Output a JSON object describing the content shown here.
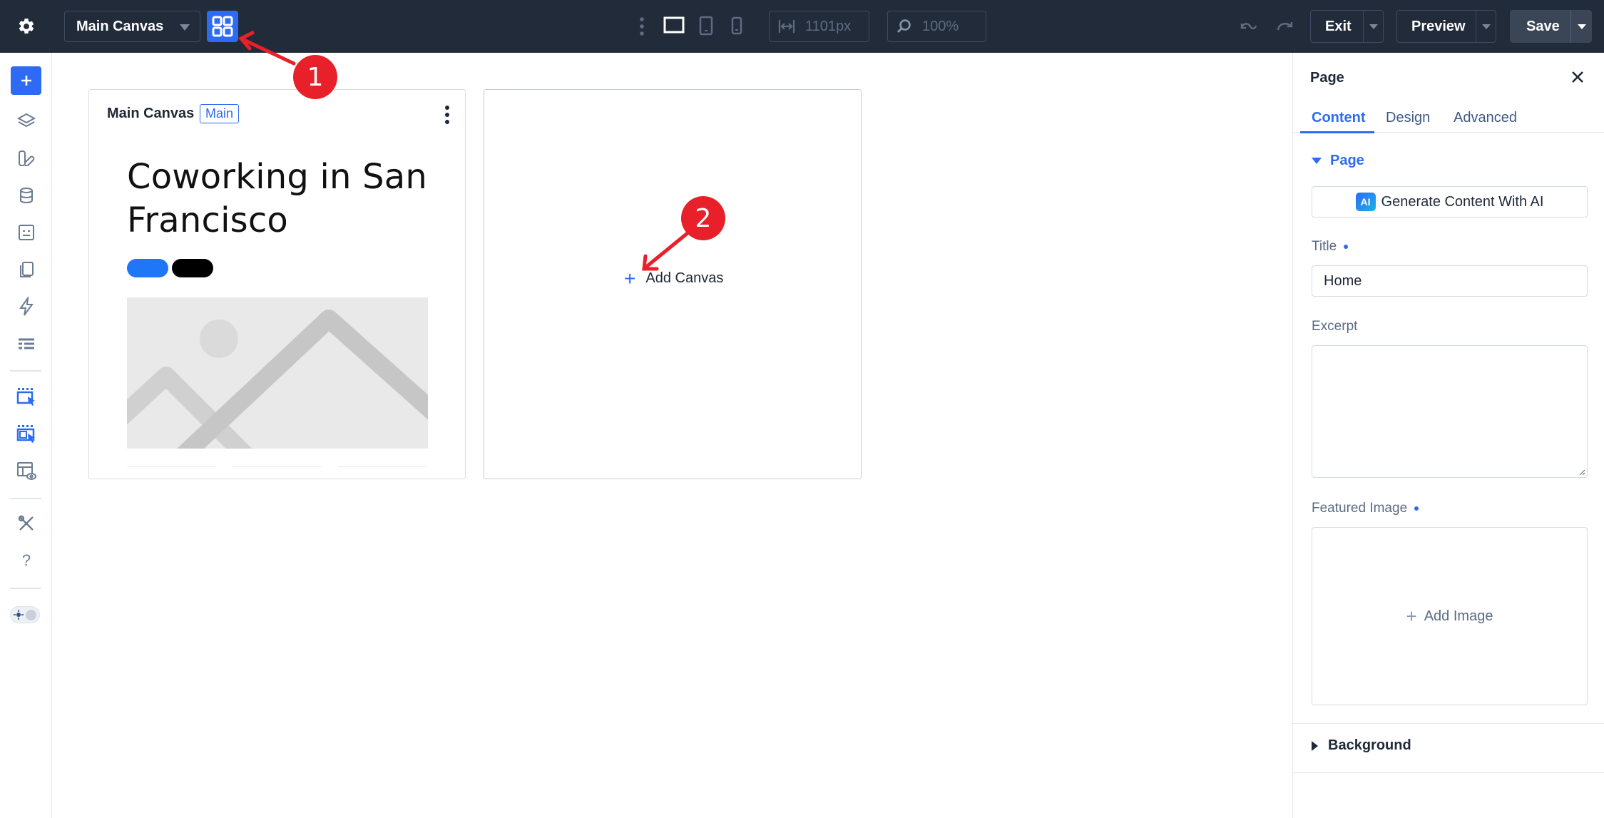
{
  "topbar": {
    "canvas_select": "Main Canvas",
    "width_value": "1101px",
    "zoom_value": "100%",
    "exit_label": "Exit",
    "preview_label": "Preview",
    "save_label": "Save"
  },
  "sidebar": {
    "icons": [
      "add-icon",
      "layers-icon",
      "global-styles-icon",
      "database-icon",
      "template-icon",
      "pages-icon",
      "lightning-icon",
      "table-icon",
      "canvas-select-icon",
      "canvas-select-alt-icon",
      "preview-layout-icon",
      "tools-icon",
      "help-icon",
      "theme-toggle"
    ]
  },
  "canvases": {
    "main": {
      "title": "Main Canvas",
      "badge": "Main",
      "hero_text": "Coworking in San Francisco"
    },
    "add_canvas_label": "Add Canvas"
  },
  "annotations": [
    "1",
    "2"
  ],
  "panel": {
    "title": "Page",
    "tabs": [
      "Content",
      "Design",
      "Advanced"
    ],
    "active_tab": "Content",
    "section_page": "Page",
    "ai_button": "Generate Content With AI",
    "ai_chip": "AI",
    "title_label": "Title",
    "title_value": "Home",
    "excerpt_label": "Excerpt",
    "featured_label": "Featured Image",
    "add_image_label": "Add Image",
    "background_label": "Background"
  },
  "colors": {
    "topbar_bg": "#212b3a",
    "accent": "#2d6bf4",
    "annotation_red": "#e8202a"
  }
}
